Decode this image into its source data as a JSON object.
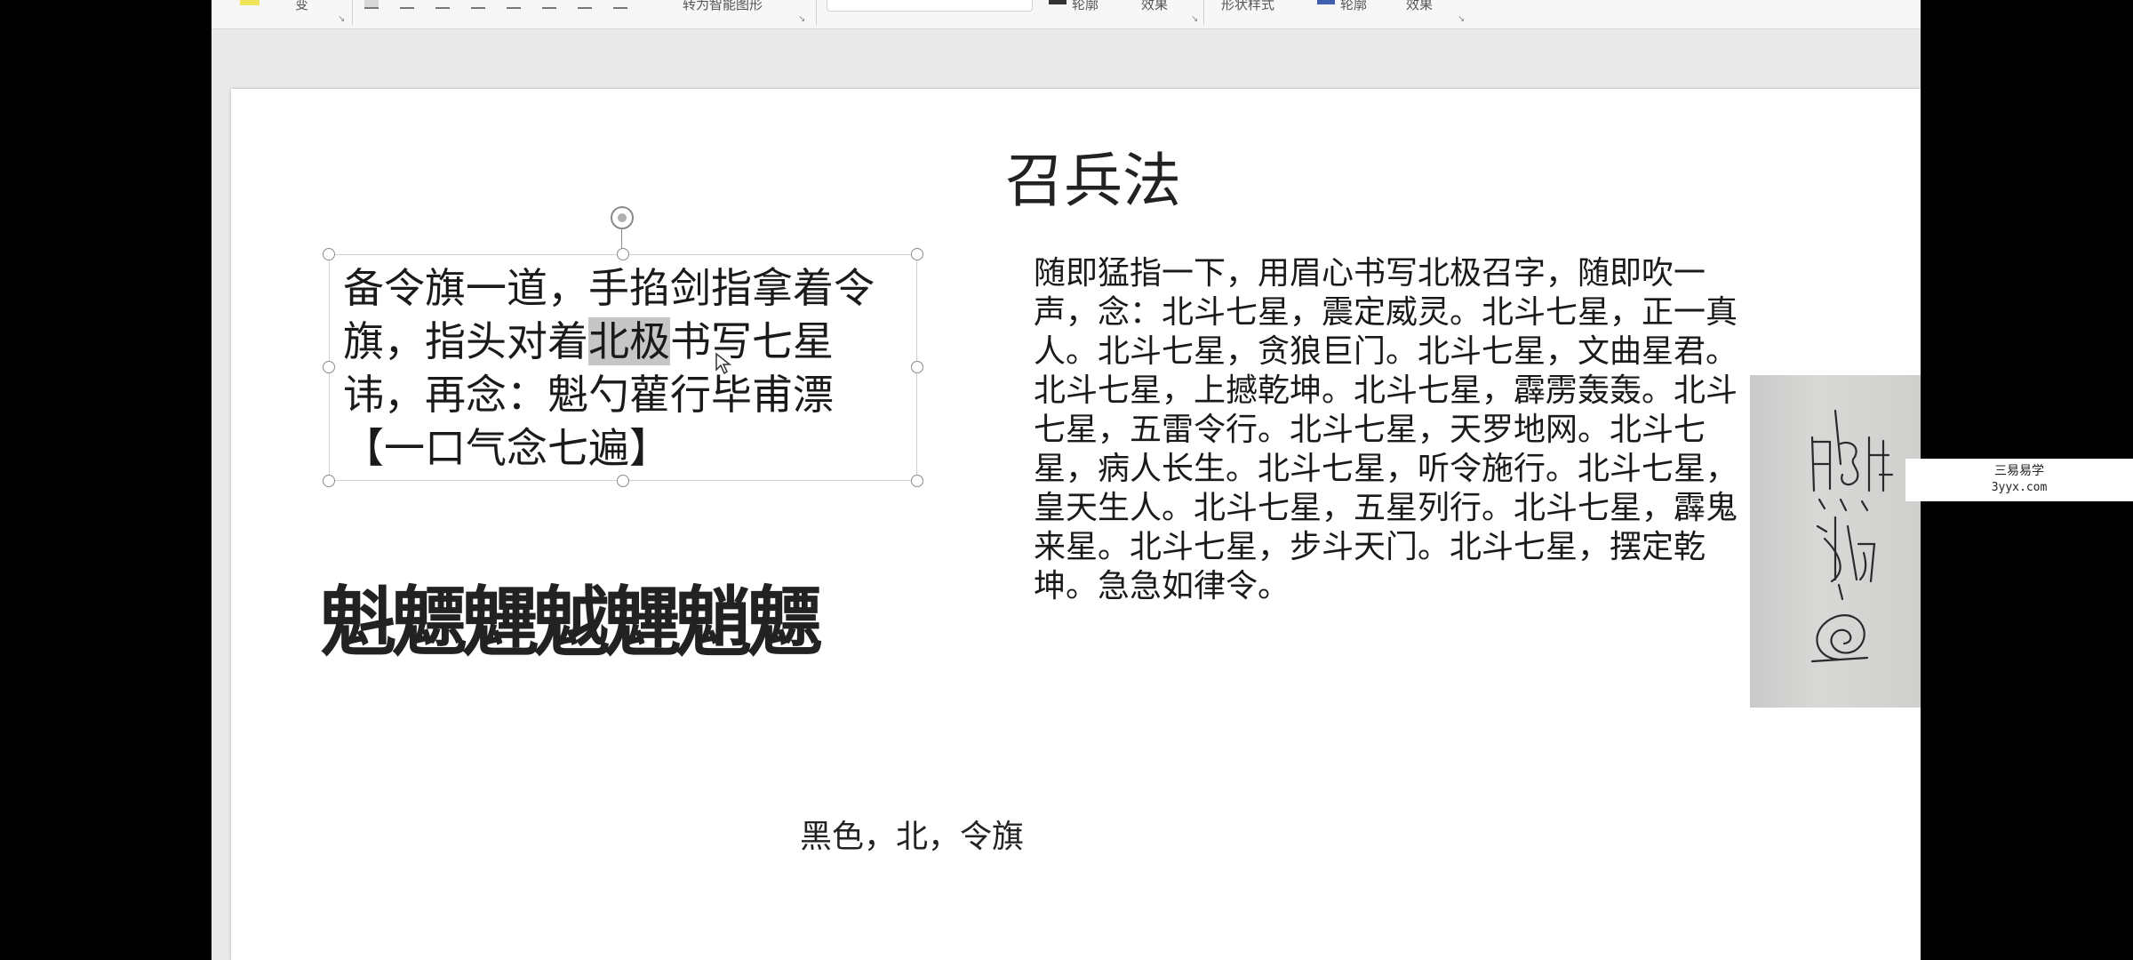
{
  "ribbon": {
    "font_size": "变",
    "paragraph_group": "转为智能图形",
    "drawing_group": "形状样式",
    "outline1": "轮廓",
    "effects1": "效果",
    "outline2": "轮廓",
    "effects2": "效果"
  },
  "slide": {
    "title": "召兵法",
    "left_text": {
      "before_highlight": "备令旗一道，手掐剑指拿着令旗，指头对着",
      "highlight": "北极",
      "after_highlight": "书写七星讳，再念：魁勺雚行毕甫漂【一口气念七遍】"
    },
    "symbol_row": "魁魒魓魆魓魈魒",
    "right_text": "随即猛指一下，用眉心书写北极召字，随即吹一声，念：北斗七星，震定威灵。北斗七星，正一真人。北斗七星，贪狼巨门。北斗七星，文曲星君。北斗七星，上撼乾坤。北斗七星，霹雳轰轰。北斗七星，五雷令行。北斗七星，天罗地网。北斗七星，病人长生。北斗七星，听令施行。北斗七星，皇天生人。北斗七星，五星列行。北斗七星，霹鬼来星。北斗七星，步斗天门。北斗七星，摆定乾坤。急急如律令。",
    "bottom_note": "黑色，北，令旗"
  },
  "watermark": {
    "line1": "三易易学",
    "line2": "3yyx.com"
  },
  "colors": {
    "ribbon_bg": "#f7f7f7",
    "workspace_bg": "#e9e9ea",
    "slide_bg": "#ffffff",
    "highlight": "#c6c6c6",
    "selection_handle": "#8a8a8a"
  }
}
